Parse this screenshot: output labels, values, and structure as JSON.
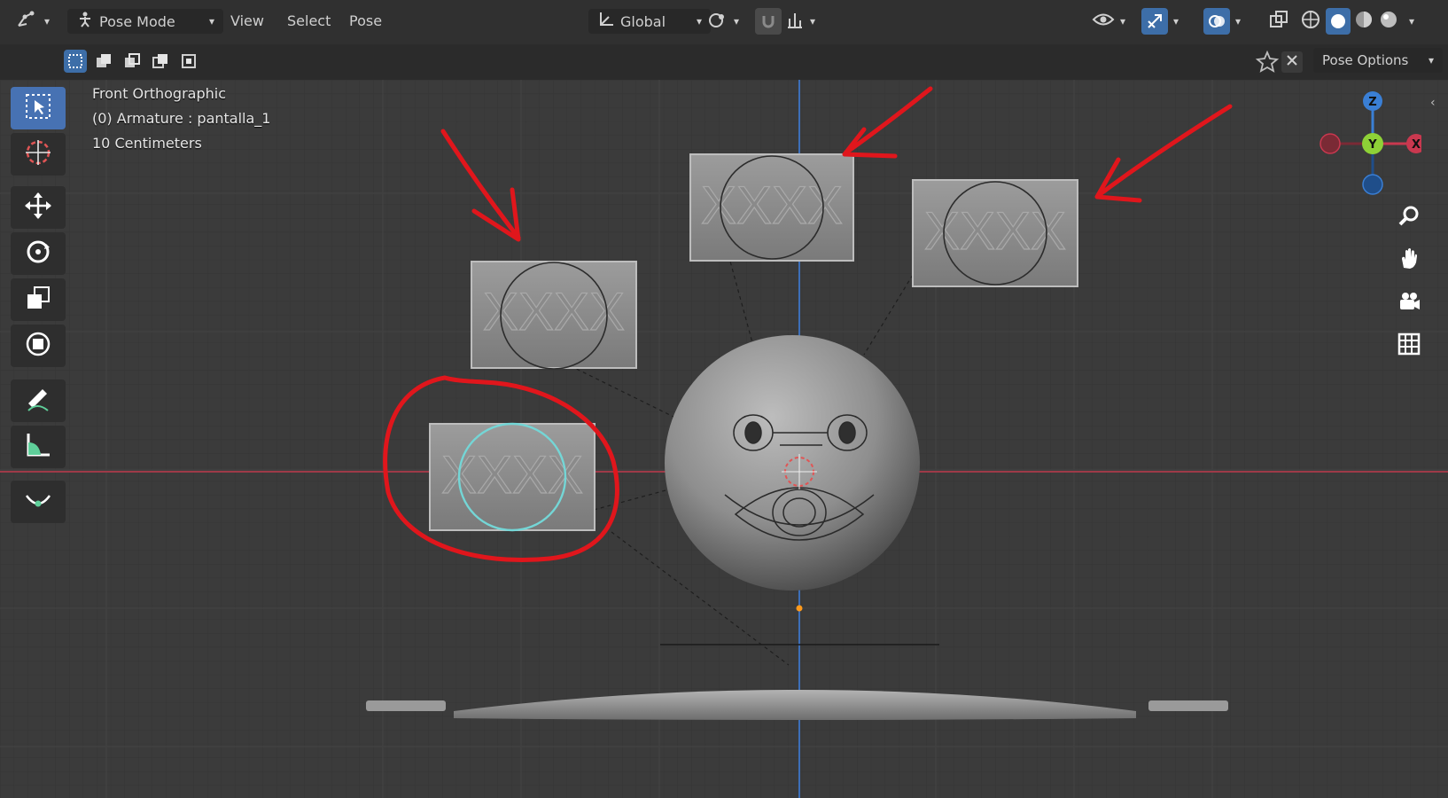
{
  "header": {
    "mode_label": "Pose Mode",
    "menu": [
      "View",
      "Select",
      "Pose"
    ],
    "orientation_label": "Global",
    "pose_options_label": "Pose Options"
  },
  "viewport": {
    "view_name": "Front Orthographic",
    "object_info": "(0) Armature : pantalla_1",
    "scale_label": "10 Centimeters"
  },
  "gizmo": {
    "z": "Z",
    "y": "Y",
    "x": "X"
  },
  "panels": {
    "text": "XXXX"
  },
  "colors": {
    "accent": "#4772b3",
    "annotation": "#e0161c",
    "axis_x": "#c9384f",
    "axis_y": "#8ed137",
    "axis_z": "#3a7fd5",
    "selection": "#74d6d6"
  }
}
